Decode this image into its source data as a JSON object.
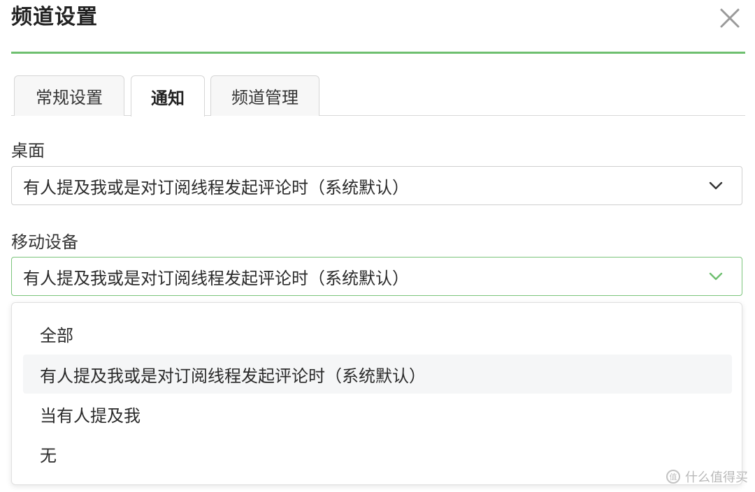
{
  "dialog": {
    "title": "频道设置"
  },
  "tabs": [
    {
      "label": "常规设置",
      "active": false
    },
    {
      "label": "通知",
      "active": true
    },
    {
      "label": "频道管理",
      "active": false
    }
  ],
  "desktop": {
    "label": "桌面",
    "value": "有人提及我或是对订阅线程发起评论时（系统默认）"
  },
  "mobile": {
    "label": "移动设备",
    "value": "有人提及我或是对订阅线程发起评论时（系统默认）"
  },
  "dropdown": {
    "options": [
      {
        "label": "全部"
      },
      {
        "label": "有人提及我或是对订阅线程发起评论时（系统默认）",
        "highlighted": true
      },
      {
        "label": "当有人提及我"
      },
      {
        "label": "无"
      }
    ]
  },
  "watermark": {
    "text": "什么值得买"
  },
  "colors": {
    "accent": "#6ebf6f",
    "focus_border": "#7bc47b",
    "chevron_default": "#333333",
    "chevron_focus": "#6ebf6f",
    "hover_bg": "#f5f6f7"
  },
  "icons": {
    "close": "close-icon",
    "chevron": "chevron-down-icon",
    "watermark": "smzdm-logo-icon"
  }
}
